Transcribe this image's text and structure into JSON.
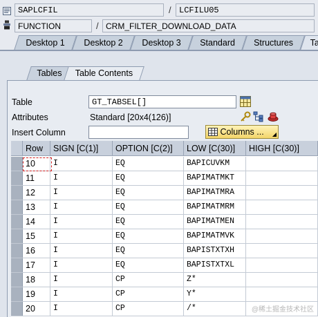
{
  "header": {
    "program": "SAPLCFIL",
    "include": "LCFILU05",
    "type": "FUNCTION",
    "name": "CRM_FILTER_DOWNLOAD_DATA",
    "separator": "/"
  },
  "tabs": [
    {
      "label": "Desktop 1"
    },
    {
      "label": "Desktop 2"
    },
    {
      "label": "Desktop 3"
    },
    {
      "label": "Standard"
    },
    {
      "label": "Structures"
    },
    {
      "label": "Ta"
    }
  ],
  "inner_tabs": [
    {
      "label": "Tables"
    },
    {
      "label": "Table Contents"
    }
  ],
  "form": {
    "table_label": "Table",
    "table_value": "GT_TABSEL[]",
    "attributes_label": "Attributes",
    "attributes_value": "Standard [20x4(126)]",
    "insert_column_label": "Insert Column",
    "insert_column_value": "",
    "columns_button": "Columns ..."
  },
  "table": {
    "columns": [
      "Row",
      "SIGN [C(1)]",
      "OPTION [C(2)]",
      "LOW [C(30)]",
      "HIGH [C(30)]"
    ],
    "rows": [
      {
        "row": "10",
        "sign": "I",
        "option": "EQ",
        "low": "BAPICUVKM",
        "high": ""
      },
      {
        "row": "11",
        "sign": "I",
        "option": "EQ",
        "low": "BAPIMATMKT",
        "high": ""
      },
      {
        "row": "12",
        "sign": "I",
        "option": "EQ",
        "low": "BAPIMATMRA",
        "high": ""
      },
      {
        "row": "13",
        "sign": "I",
        "option": "EQ",
        "low": "BAPIMATMRM",
        "high": ""
      },
      {
        "row": "14",
        "sign": "I",
        "option": "EQ",
        "low": "BAPIMATMEN",
        "high": ""
      },
      {
        "row": "15",
        "sign": "I",
        "option": "EQ",
        "low": "BAPIMATMVK",
        "high": ""
      },
      {
        "row": "16",
        "sign": "I",
        "option": "EQ",
        "low": "BAPISTXTXH",
        "high": ""
      },
      {
        "row": "17",
        "sign": "I",
        "option": "EQ",
        "low": "BAPISTXTXL",
        "high": ""
      },
      {
        "row": "18",
        "sign": "I",
        "option": "CP",
        "low": "Z*",
        "high": ""
      },
      {
        "row": "19",
        "sign": "I",
        "option": "CP",
        "low": "Y*",
        "high": ""
      },
      {
        "row": "20",
        "sign": "I",
        "option": "CP",
        "low": "/*",
        "high": ""
      }
    ]
  },
  "watermark": "@稀土掘金技术社区",
  "colors": {
    "background": "#e7eaf0",
    "columns_button": "#f3d56a",
    "focus": "#d02020"
  }
}
